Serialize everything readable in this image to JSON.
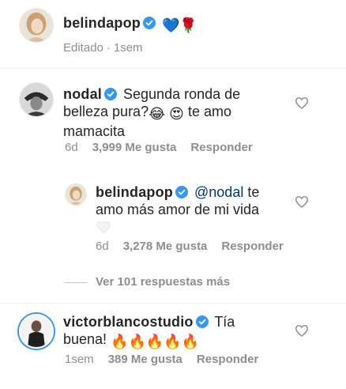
{
  "caption": {
    "username": "belindapop",
    "emoji_text": "💙🌹",
    "edited_label": "Editado",
    "time": "1sem"
  },
  "comments": [
    {
      "username": "nodal",
      "text_line1": "Segunda ronda de",
      "text_line2_a": "belleza pura?",
      "text_line2_b": "te amo",
      "text_line3": "mamacita",
      "time": "6d",
      "likes": "3,999 Me gusta",
      "reply_label": "Responder"
    },
    {
      "username": "belindapop",
      "mention": "@nodal",
      "text_line1": "te",
      "text_line2": "amo más amor de mi vida",
      "time": "6d",
      "likes": "3,278 Me gusta",
      "reply_label": "Responder"
    },
    {
      "username": "victorblancostudio",
      "text_line1": "Tía",
      "text_line2": "buena!",
      "time": "1sem",
      "likes": "389 Me gusta",
      "reply_label": "Responder"
    }
  ],
  "view_replies": "Ver 101 respuestas más",
  "colors": {
    "verified_blue": "#3897f0",
    "meta_gray": "#8e8e8e",
    "mention_blue": "#00376b",
    "divider": "#efefef"
  }
}
